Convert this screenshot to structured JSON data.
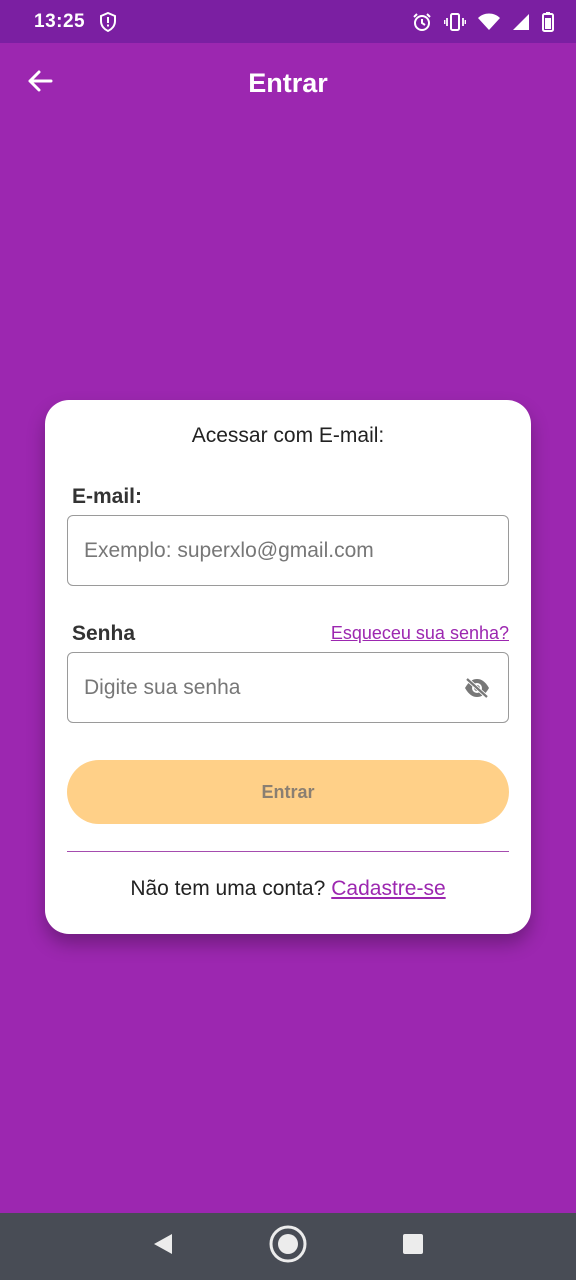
{
  "status_bar": {
    "time": "13:25",
    "icons": [
      "shield-alert-icon",
      "alarm-icon",
      "vibrate-icon",
      "wifi-icon",
      "signal-icon",
      "battery-icon"
    ]
  },
  "app_bar": {
    "title": "Entrar",
    "back_icon": "arrow-back-icon"
  },
  "login_card": {
    "heading": "Acessar com E-mail:",
    "email": {
      "label": "E-mail:",
      "placeholder": "Exemplo: superxlo@gmail.com",
      "value": ""
    },
    "password": {
      "label": "Senha",
      "placeholder": "Digite sua senha",
      "value": "",
      "forgot_link": "Esqueceu sua senha?",
      "visibility_icon": "eye-off-icon"
    },
    "submit_label": "Entrar",
    "signup_prompt": "Não tem uma conta?",
    "signup_link": "Cadastre-se"
  },
  "nav_bar": {
    "icons": [
      "back-triangle-icon",
      "home-circle-icon",
      "recents-square-icon"
    ]
  },
  "colors": {
    "background": "#9c27b0",
    "status_bar": "#7b1fa2",
    "button": "#ffd088",
    "link": "#9c27b0",
    "nav_bar": "#484c55"
  }
}
